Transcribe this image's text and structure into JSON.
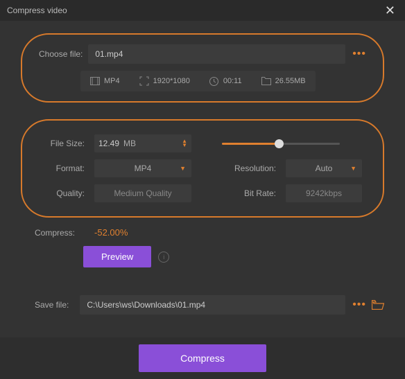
{
  "titlebar": {
    "title": "Compress video"
  },
  "choose": {
    "label": "Choose file:",
    "value": "01.mp4",
    "meta": {
      "format": "MP4",
      "resolution": "1920*1080",
      "duration": "00:11",
      "size": "26.55MB"
    }
  },
  "settings": {
    "filesize": {
      "label": "File Size:",
      "value": "12.49",
      "unit": "MB"
    },
    "format": {
      "label": "Format:",
      "value": "MP4"
    },
    "resolution": {
      "label": "Resolution:",
      "value": "Auto"
    },
    "quality": {
      "label": "Quality:",
      "value": "Medium Quality"
    },
    "bitrate": {
      "label": "Bit Rate:",
      "value": "9242kbps"
    }
  },
  "compress": {
    "label": "Compress:",
    "value": "-52.00%"
  },
  "preview": {
    "label": "Preview"
  },
  "save": {
    "label": "Save file:",
    "value": "C:\\Users\\ws\\Downloads\\01.mp4"
  },
  "action": {
    "compress": "Compress"
  }
}
